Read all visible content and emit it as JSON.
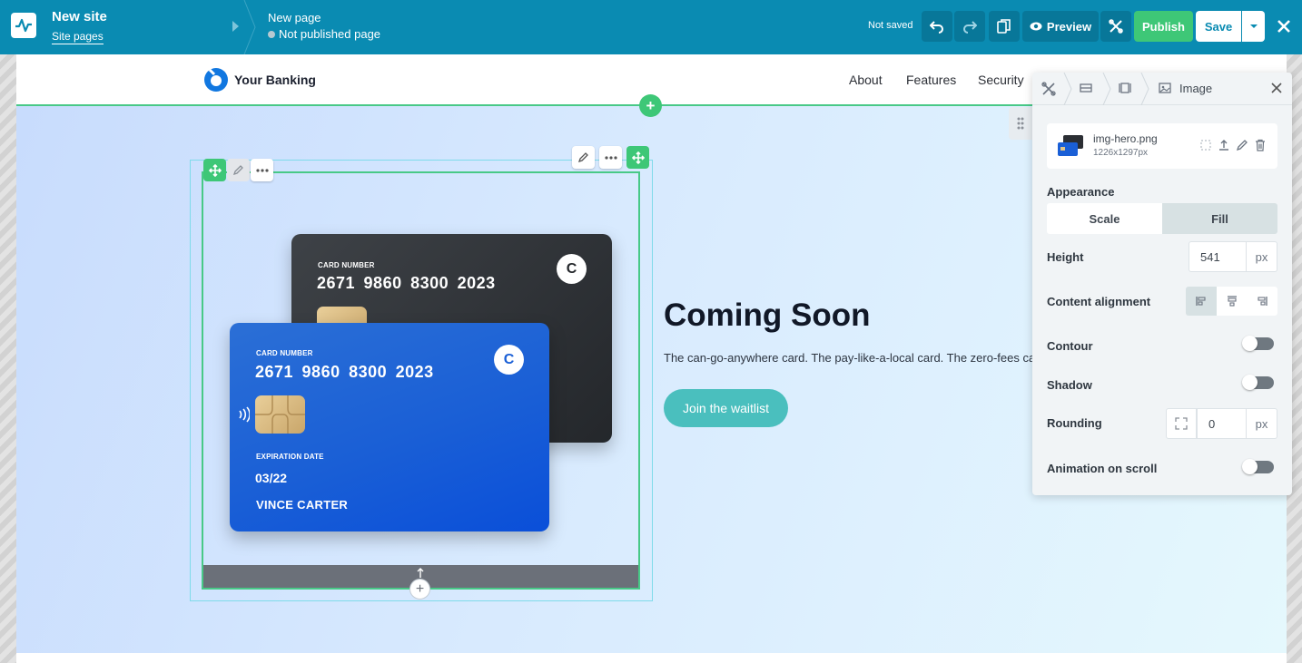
{
  "topbar": {
    "site_title": "New site",
    "site_pages_link": "Site pages",
    "page_name": "New page",
    "page_status": "Not published page",
    "save_status": "Not saved",
    "preview_label": "Preview",
    "publish_label": "Publish",
    "save_label": "Save"
  },
  "site": {
    "brand_name": "Your Banking",
    "nav": [
      "About",
      "Features",
      "Security"
    ],
    "hero_title": "Coming Soon",
    "hero_subtitle": "The can-go-anywhere card. The pay-like-a-local card. The zero-fees card.",
    "cta_label": "Join the waitlist"
  },
  "cards": {
    "black": {
      "label": "CARD NUMBER",
      "number": "2671 9860 8300 2023",
      "logo": "C"
    },
    "blue": {
      "label": "CARD NUMBER",
      "number": "2671 9860 8300 2023",
      "logo": "C",
      "exp_label": "EXPIRATION DATE",
      "exp_value": "03/22",
      "holder": "VINCE CARTER"
    }
  },
  "panel": {
    "title": "Image",
    "file_name": "img-hero.png",
    "file_size": "1226x1297px",
    "appearance_label": "Appearance",
    "appearance_options": [
      "Scale",
      "Fill"
    ],
    "appearance_selected": "Fill",
    "height_label": "Height",
    "height_value": "541",
    "height_unit": "px",
    "alignment_label": "Content alignment",
    "contour_label": "Contour",
    "contour_on": false,
    "shadow_label": "Shadow",
    "shadow_on": false,
    "rounding_label": "Rounding",
    "rounding_value": "0",
    "rounding_unit": "px",
    "animation_label": "Animation on scroll",
    "animation_on": false
  },
  "colors": {
    "topbar": "#0a8bb2",
    "publish": "#3ec777",
    "cta": "#4abfbe",
    "selection": "#48c987"
  }
}
